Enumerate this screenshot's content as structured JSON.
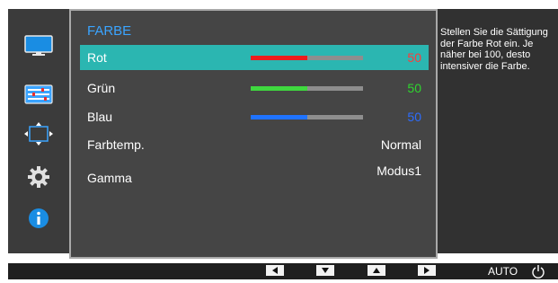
{
  "menu": {
    "title": "FARBE",
    "items": [
      {
        "label": "Rot",
        "value": "50",
        "level": 0.5,
        "bar_color": "#ee1c1c",
        "value_color": "#ff3a3a",
        "selected": true
      },
      {
        "label": "Grün",
        "value": "50",
        "level": 0.5,
        "bar_color": "#3fd93f",
        "value_color": "#2ed62e",
        "selected": false
      },
      {
        "label": "Blau",
        "value": "50",
        "level": 0.5,
        "bar_color": "#1f73ff",
        "value_color": "#2d6dff",
        "selected": false
      },
      {
        "label": "Farbtemp.",
        "value": "Normal"
      },
      {
        "label": "Gamma",
        "value": "Modus1"
      }
    ]
  },
  "help_text": "Stellen Sie die Sättigung der Farbe Rot ein. Je näher bei 100, desto intensiver die Farbe.",
  "sidebar_icons": [
    "monitor-icon",
    "picture-adjust-icon",
    "screen-size-icon",
    "gear-icon",
    "info-icon"
  ],
  "bottom_bar": {
    "buttons": [
      "arrow-left-icon",
      "arrow-down-icon",
      "arrow-up-icon",
      "arrow-right-icon"
    ],
    "auto_label": "AUTO",
    "power_icon": "power-icon"
  },
  "colors": {
    "accent_title": "#3aa4ff",
    "selected_row": "#2bb6b1",
    "panel_bg": "#454545",
    "osd_bg": "#313131"
  }
}
